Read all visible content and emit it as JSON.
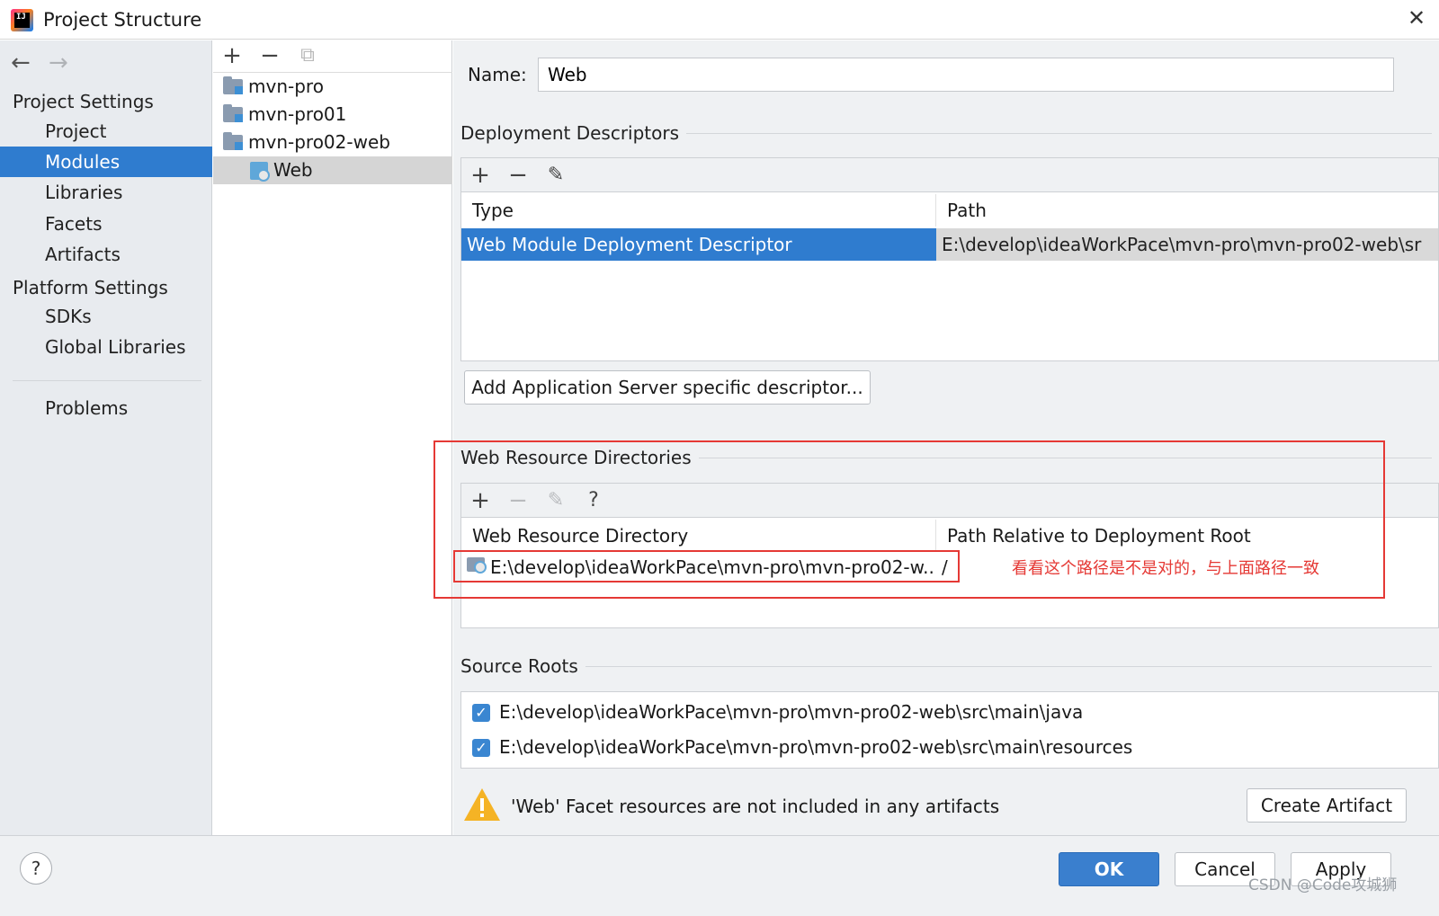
{
  "window": {
    "title": "Project Structure",
    "close_glyph": "✕"
  },
  "nav": {
    "back_glyph": "←",
    "forward_glyph": "→",
    "project_settings_header": "Project Settings",
    "project_settings_items": [
      "Project",
      "Modules",
      "Libraries",
      "Facets",
      "Artifacts"
    ],
    "platform_settings_header": "Platform Settings",
    "platform_settings_items": [
      "SDKs",
      "Global Libraries"
    ],
    "problems": "Problems",
    "selected_item": "Modules"
  },
  "tree": {
    "toolbar": {
      "add_glyph": "+",
      "remove_glyph": "−",
      "copy_glyph": "⧉"
    },
    "items": [
      "mvn-pro",
      "mvn-pro01",
      "mvn-pro02-web",
      "Web"
    ],
    "selected_item": "Web"
  },
  "facet": {
    "name_label": "Name:",
    "name_value": "Web",
    "deployment_descriptors": {
      "title": "Deployment Descriptors",
      "toolbar": {
        "add_glyph": "+",
        "remove_glyph": "−",
        "edit_glyph": "✎"
      },
      "columns": [
        "Type",
        "Path"
      ],
      "rows": [
        {
          "type": "Web Module Deployment Descriptor",
          "path": "E:\\develop\\ideaWorkPace\\mvn-pro\\mvn-pro02-web\\sr"
        }
      ],
      "add_server_button": "Add Application Server specific descriptor..."
    },
    "web_resource_directories": {
      "title": "Web Resource Directories",
      "toolbar": {
        "add_glyph": "+",
        "remove_glyph": "−",
        "edit_glyph": "✎",
        "help_glyph": "?"
      },
      "columns": [
        "Web Resource Directory",
        "Path Relative to Deployment Root"
      ],
      "rows": [
        {
          "directory": "E:\\develop\\ideaWorkPace\\mvn-pro\\mvn-pro02-w...",
          "relative_path": "/"
        }
      ],
      "annotation": "看看这个路径是不是对的，与上面路径一致"
    },
    "source_roots": {
      "title": "Source Roots",
      "items": [
        {
          "checked": true,
          "path": "E:\\develop\\ideaWorkPace\\mvn-pro\\mvn-pro02-web\\src\\main\\java"
        },
        {
          "checked": true,
          "path": "E:\\develop\\ideaWorkPace\\mvn-pro\\mvn-pro02-web\\src\\main\\resources"
        }
      ]
    },
    "warning": {
      "text": "'Web' Facet resources are not included in any artifacts",
      "button": "Create Artifact"
    }
  },
  "footer": {
    "help_glyph": "?",
    "ok": "OK",
    "cancel": "Cancel",
    "apply": "Apply",
    "watermark": "CSDN @Code攻城狮"
  },
  "colors": {
    "selection": "#2f7ccf",
    "annotation_red": "#e53935",
    "sidebar_bg": "#e8ebef",
    "content_bg": "#eff1f3"
  }
}
